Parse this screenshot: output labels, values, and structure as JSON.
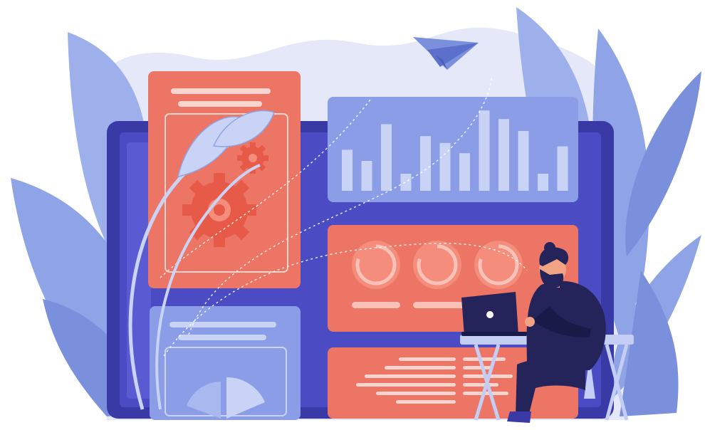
{
  "scene": {
    "subject": "dashboard-illustration",
    "colors": {
      "background": "#ffffff",
      "blob": "#e4e8f8",
      "leaf": "#8ea4e6",
      "leaf_dark": "#7b90dc",
      "monitor": "#3a3aa6",
      "monitor_inner": "#4b4bc4",
      "card_blue": "#8a9de6",
      "card_red": "#ec7565",
      "card_red_light": "#f48d7b",
      "accent_light": "#c9d3f6",
      "person": "#24245a",
      "skin": "#f1a384",
      "table": "#c4cdf3"
    },
    "icons": [
      "paper-plane-icon",
      "gear-icon",
      "laptop-icon",
      "pie-chart-icon"
    ],
    "bar_panel": {
      "type": "bar",
      "values": [
        0.48,
        0.35,
        0.78,
        0.2,
        0.64,
        0.56,
        0.44,
        0.94,
        0.84,
        0.7,
        0.2,
        0.52
      ]
    },
    "progress_rings": [
      0.8,
      0.8,
      0.8
    ]
  }
}
